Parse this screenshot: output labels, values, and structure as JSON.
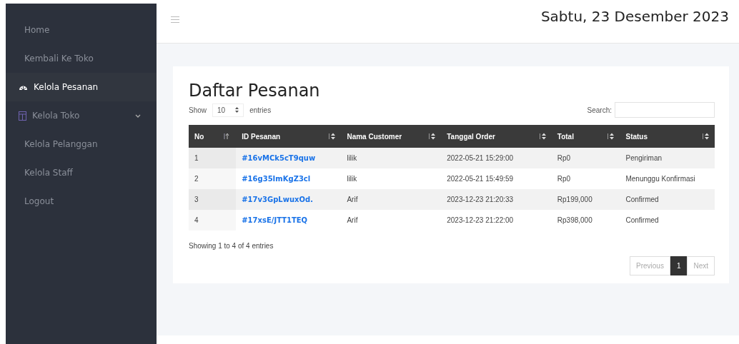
{
  "sidebar": {
    "items": [
      {
        "label": "Home",
        "kind": "link",
        "selected": false
      },
      {
        "label": "Kembali Ke Toko",
        "kind": "link",
        "selected": false
      },
      {
        "label": "Kelola Pesanan",
        "kind": "icon-link",
        "selected": true
      },
      {
        "label": "Kelola Toko",
        "kind": "dropdown",
        "selected": false,
        "expanded": false
      },
      {
        "label": "Kelola Pelanggan",
        "kind": "link",
        "selected": false
      },
      {
        "label": "Kelola Staff",
        "kind": "link",
        "selected": false
      },
      {
        "label": "Logout",
        "kind": "link",
        "selected": false
      }
    ]
  },
  "header": {
    "date": "Sabtu, 23 Desember 2023"
  },
  "card": {
    "title": "Daftar Pesanan",
    "length": {
      "prefix": "Show",
      "value": "10",
      "suffix": "entries"
    },
    "search": {
      "label": "Search:"
    },
    "table": {
      "columns": [
        {
          "label": "No",
          "sorted": true
        },
        {
          "label": "ID Pesanan",
          "sorted": false
        },
        {
          "label": "Nama Customer",
          "sorted": false
        },
        {
          "label": "Tanggal Order",
          "sorted": false
        },
        {
          "label": "Total",
          "sorted": false
        },
        {
          "label": "Status",
          "sorted": false
        }
      ],
      "rows": [
        [
          "1",
          "#16vMCk5cT9quw",
          "lilik",
          "2022-05-21 15:29:00",
          "Rp0",
          "Pengiriman"
        ],
        [
          "2",
          "#16g35ImKgZ3cl",
          "lilik",
          "2022-05-21 15:49:59",
          "Rp0",
          "Menunggu Konfirmasi"
        ],
        [
          "3",
          "#17v3GpLwuxOd.",
          "Arif",
          "2023-12-23 21:20:33",
          "Rp199,000",
          "Confirmed"
        ],
        [
          "4",
          "#17xsE/JTT1TEQ",
          "Arif",
          "2023-12-23 21:22:00",
          "Rp398,000",
          "Confirmed"
        ]
      ]
    },
    "info": "Showing 1 to 4 of 4 entries",
    "pagination": [
      {
        "label": "Previous",
        "disabled": true,
        "selected": false
      },
      {
        "label": "1",
        "disabled": false,
        "selected": true
      },
      {
        "label": "Next",
        "disabled": true,
        "selected": false
      }
    ]
  }
}
